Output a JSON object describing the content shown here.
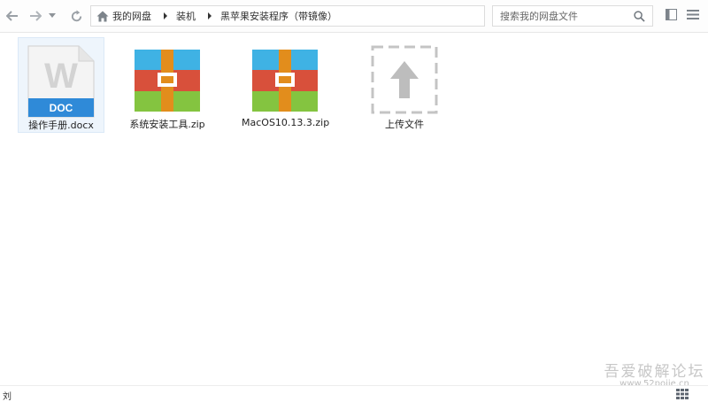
{
  "nav": {
    "back_icon": "arrow-left-icon",
    "forward_icon": "arrow-right-icon",
    "dropdown_icon": "chevron-down-icon",
    "refresh_icon": "refresh-icon"
  },
  "breadcrumb": {
    "items": [
      {
        "label": "我的网盘",
        "icon": "home-icon"
      },
      {
        "label": "装机"
      },
      {
        "label": "黑苹果安装程序（带镜像）"
      }
    ]
  },
  "search": {
    "placeholder": "搜索我的网盘文件",
    "value": "",
    "icon": "search-icon"
  },
  "view": {
    "icons": [
      "layout-panel-icon",
      "list-view-icon"
    ]
  },
  "files": [
    {
      "name": "操作手册.docx",
      "type": "doc",
      "badge": "DOC",
      "letter": "W",
      "selected": true
    },
    {
      "name": "系统安装工具.zip",
      "type": "zip"
    },
    {
      "name": "MacOS10.13.3.zip",
      "type": "zip"
    },
    {
      "name": "上传文件",
      "type": "upload"
    }
  ],
  "status": {
    "text": "刘"
  },
  "watermark": {
    "line1": "吾爱破解论坛",
    "line2": "www.52pojie.cn"
  }
}
